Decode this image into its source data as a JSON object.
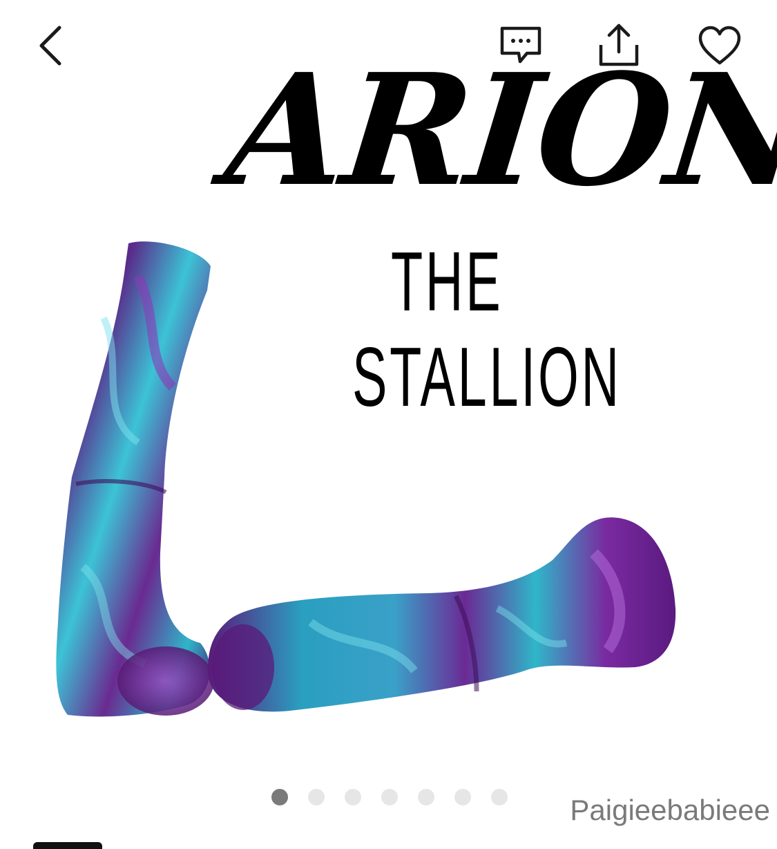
{
  "header": {
    "back_icon": "chevron-left-icon",
    "chat_icon": "message-dots-icon",
    "share_icon": "share-upload-icon",
    "favorite_icon": "heart-outline-icon"
  },
  "product": {
    "title_line1": "ARION",
    "title_line2": "THE",
    "title_line3": "STALLION",
    "colors": {
      "teal": "#2fb6c9",
      "purple": "#6a1f86",
      "deep_purple": "#4a1166"
    }
  },
  "gallery": {
    "page_count": 7,
    "active_index": 0
  },
  "watermark": {
    "text": "Paigieebabieee"
  }
}
